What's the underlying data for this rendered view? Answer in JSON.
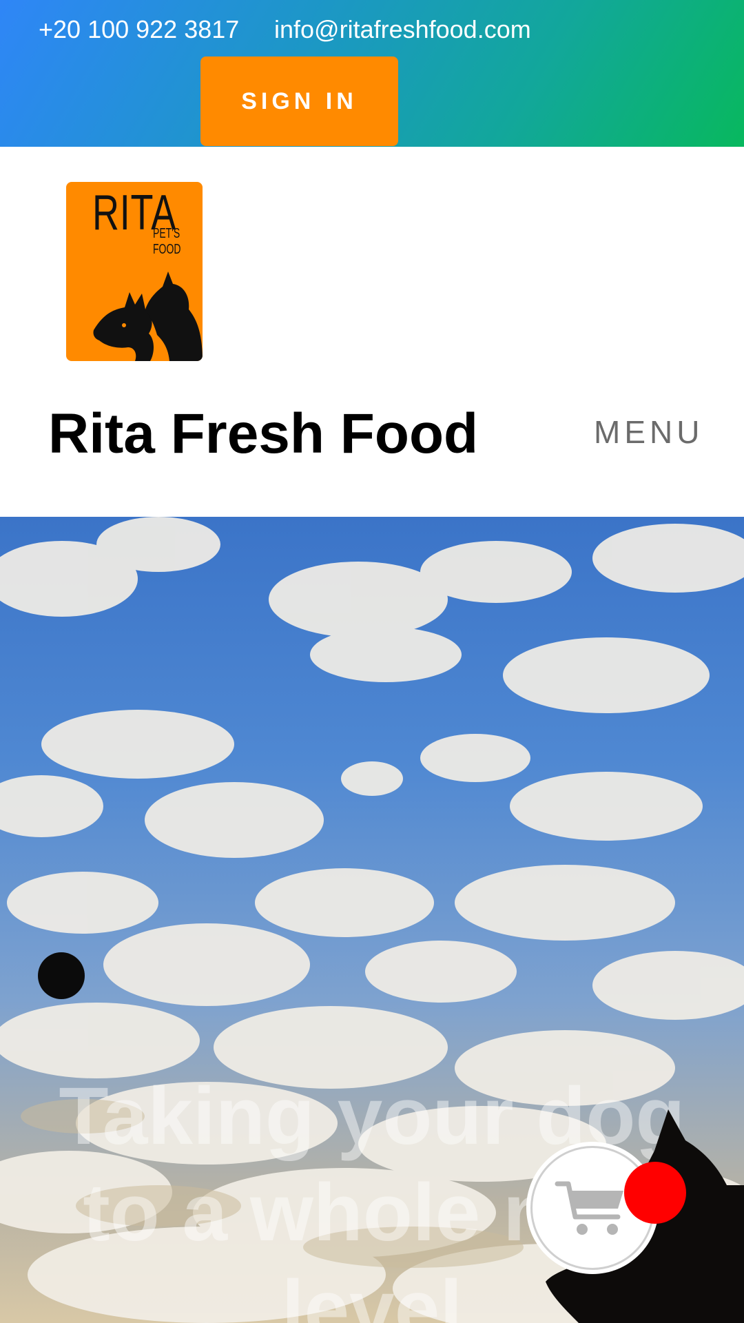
{
  "topbar": {
    "phone": "+20 100 922 3817",
    "email": "info@ritafreshfood.com",
    "signin_label": "SIGN IN"
  },
  "header": {
    "logo": {
      "name": "RITA",
      "subtitle": "PET'S FOOD"
    },
    "site_title": "Rita Fresh Food",
    "menu_label": "MENU"
  },
  "hero": {
    "heading": "Taking your dog to a whole new level"
  },
  "icons": {
    "cart": "cart-icon",
    "slider_dot": "slider-dot"
  },
  "colors": {
    "brand_orange": "#ff8a00",
    "gradient_start": "#2f86f7",
    "gradient_end": "#08b85e",
    "badge": "#ff0000"
  }
}
